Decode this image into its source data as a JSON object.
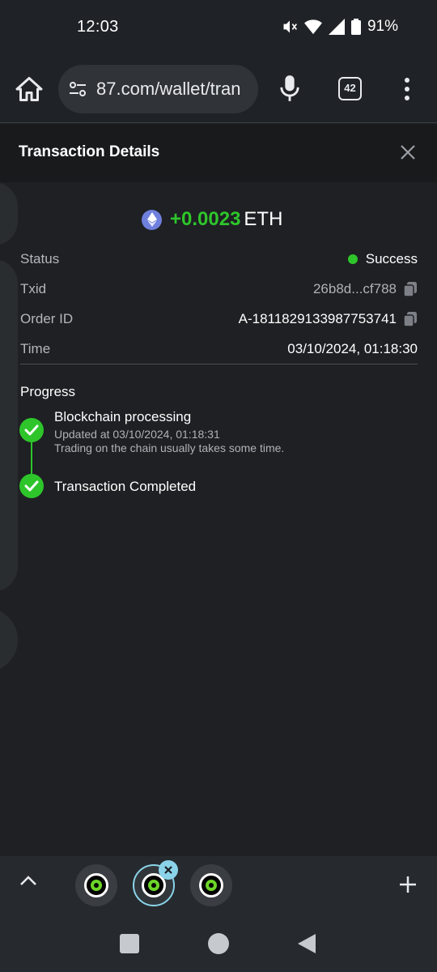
{
  "status_bar": {
    "time": "12:03",
    "battery": "91%",
    "icons": [
      "mute-icon",
      "wifi-icon",
      "signal-icon",
      "battery-icon"
    ]
  },
  "browser": {
    "url": "87.com/wallet/tran",
    "tab_count": "42",
    "icons": [
      "home-icon",
      "site-settings-icon",
      "mic-icon",
      "tab-switcher-icon",
      "more-vert-icon"
    ]
  },
  "panel": {
    "title": "Transaction Details",
    "amount_value": "+0.0023",
    "amount_unit": "ETH",
    "details": {
      "status_label": "Status",
      "status_value": "Success",
      "txid_label": "Txid",
      "txid_value": "26b8d...cf788",
      "order_label": "Order ID",
      "order_value": "A-1811829133987753741",
      "time_label": "Time",
      "time_value": "03/10/2024, 01:18:30"
    },
    "progress": {
      "title": "Progress",
      "steps": [
        {
          "title": "Blockchain processing",
          "updated": "Updated at 03/10/2024, 01:18:31",
          "note": "Trading on the chain usually takes some time."
        },
        {
          "title": "Transaction Completed"
        }
      ]
    }
  },
  "colors": {
    "accent_green": "#2ec52b",
    "tab_active": "#8bd3e9",
    "eth_blue": "#6f7fdc"
  }
}
